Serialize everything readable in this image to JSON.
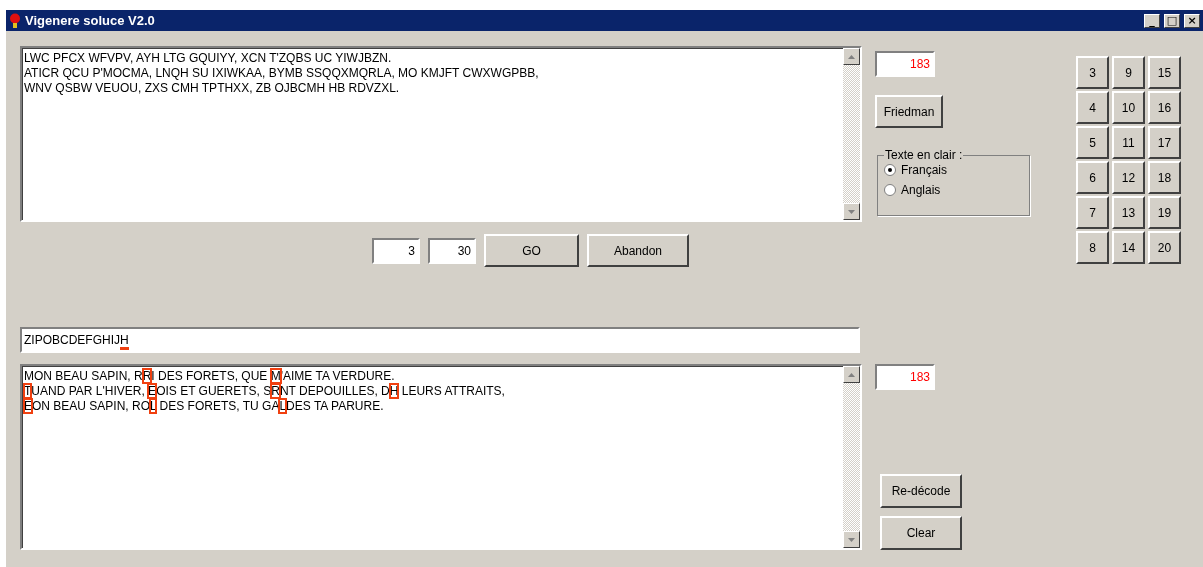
{
  "window": {
    "title": "Vigenere soluce  V2.0",
    "controls": [
      "_",
      "□",
      "×"
    ]
  },
  "cipher_text": {
    "lines": [
      "LWC PFCX WFVPV, AYH LTG GQUIYY, XCN T'ZQBS UC YIWJBZN.",
      "ATICR QCU P'MOCMA, LNQH SU IXIWKAA, BYMB SSQQXMQRLA, MO KMJFT CWXWGPBB,",
      "WNV QSBW VEUOU, ZXS CMH TPTHXX, ZB OJBCMH HB RDVZXL."
    ]
  },
  "cipher_count": "183",
  "friedman_button": "Friedman",
  "language_group": {
    "label": "Texte en clair :",
    "options": [
      {
        "label": "Français",
        "selected": true
      },
      {
        "label": "Anglais",
        "selected": false
      }
    ]
  },
  "key_lengths": [
    [
      "3",
      "9",
      "15"
    ],
    [
      "4",
      "10",
      "16"
    ],
    [
      "5",
      "11",
      "17"
    ],
    [
      "6",
      "12",
      "18"
    ],
    [
      "7",
      "13",
      "19"
    ],
    [
      "8",
      "14",
      "20"
    ]
  ],
  "range_from": "3",
  "range_to": "30",
  "go_button": "GO",
  "abandon_button": "Abandon",
  "key_field": {
    "segments": [
      {
        "text": "ZIPOBCDEFGHIJ",
        "flagged": false
      },
      {
        "text": "H",
        "flagged": true
      }
    ]
  },
  "plain_text": {
    "lines": [
      {
        "segments": [
          {
            "text": "MON BEAU SAPIN, R",
            "flagged": false
          },
          {
            "text": "R",
            "flagged": true
          },
          {
            "text": "I DES FORETS, QUE ",
            "flagged": false
          },
          {
            "text": "M",
            "flagged": true
          },
          {
            "text": "'AIME TA VERDURE.",
            "flagged": false
          }
        ]
      },
      {
        "segments": [
          {
            "text": "T",
            "flagged": true
          },
          {
            "text": "UAND PAR L'HIVER, ",
            "flagged": false
          },
          {
            "text": "E",
            "flagged": true
          },
          {
            "text": "OIS ET GUERETS, S",
            "flagged": false
          },
          {
            "text": "R",
            "flagged": true
          },
          {
            "text": "NT DEPOUILLES, D",
            "flagged": false
          },
          {
            "text": "H",
            "flagged": true
          },
          {
            "text": " LEURS ATTRAITS,",
            "flagged": false
          }
        ]
      },
      {
        "segments": [
          {
            "text": "E",
            "flagged": true
          },
          {
            "text": "ON BEAU SAPIN, RO",
            "flagged": false
          },
          {
            "text": "L",
            "flagged": true
          },
          {
            "text": " DES FORETS, TU GA",
            "flagged": false
          },
          {
            "text": "L",
            "flagged": true
          },
          {
            "text": "DES TA PARURE.",
            "flagged": false
          }
        ]
      }
    ]
  },
  "plain_count": "183",
  "redecode_button": "Re-décode",
  "clear_button": "Clear"
}
